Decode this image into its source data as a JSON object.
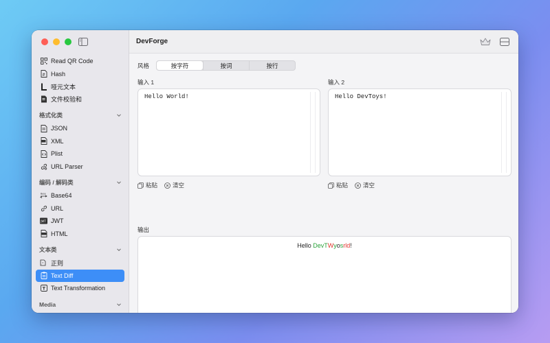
{
  "app": {
    "title": "DevForge"
  },
  "sidebar": {
    "items_top": [
      {
        "label": "Read QR Code",
        "icon": "qr-icon"
      },
      {
        "label": "Hash",
        "icon": "hash-icon"
      },
      {
        "label": "哑元文本",
        "icon": "lorem-icon"
      },
      {
        "label": "文件校验和",
        "icon": "checksum-icon"
      }
    ],
    "sections": [
      {
        "title": "格式化类",
        "items": [
          {
            "label": "JSON",
            "icon": "json-icon"
          },
          {
            "label": "XML",
            "icon": "xml-icon"
          },
          {
            "label": "Plist",
            "icon": "plist-icon"
          },
          {
            "label": "URL Parser",
            "icon": "url-parser-icon"
          }
        ]
      },
      {
        "title": "编码 / 解码类",
        "items": [
          {
            "label": "Base64",
            "icon": "base64-icon"
          },
          {
            "label": "URL",
            "icon": "link-icon"
          },
          {
            "label": "JWT",
            "icon": "jwt-icon"
          },
          {
            "label": "HTML",
            "icon": "html-icon"
          }
        ]
      },
      {
        "title": "文本类",
        "items": [
          {
            "label": "正则",
            "icon": "regex-icon"
          },
          {
            "label": "Text Diff",
            "icon": "text-diff-icon",
            "active": true
          },
          {
            "label": "Text Transformation",
            "icon": "text-transform-icon"
          }
        ]
      },
      {
        "title": "Media",
        "items": []
      }
    ]
  },
  "main": {
    "style_label": "风格",
    "style_options": [
      "按字符",
      "按词",
      "按行"
    ],
    "style_selected": "按字符",
    "input1": {
      "label": "输入 1",
      "value": "Hello World!"
    },
    "input2": {
      "label": "输入 2",
      "value": "Hello DevToys!"
    },
    "paste_label": "粘贴",
    "clear_label": "清空",
    "output": {
      "label": "输出",
      "segments": [
        {
          "text": "Hello ",
          "type": "same"
        },
        {
          "text": "DevT",
          "type": "added"
        },
        {
          "text": "W",
          "type": "removed"
        },
        {
          "text": "y",
          "type": "added"
        },
        {
          "text": "o",
          "type": "same"
        },
        {
          "text": "s",
          "type": "added"
        },
        {
          "text": "rld",
          "type": "removed"
        },
        {
          "text": "!",
          "type": "same"
        }
      ]
    }
  },
  "colors": {
    "accent": "#3d8ef7",
    "added": "#2aa33a",
    "removed": "#e0342c"
  }
}
